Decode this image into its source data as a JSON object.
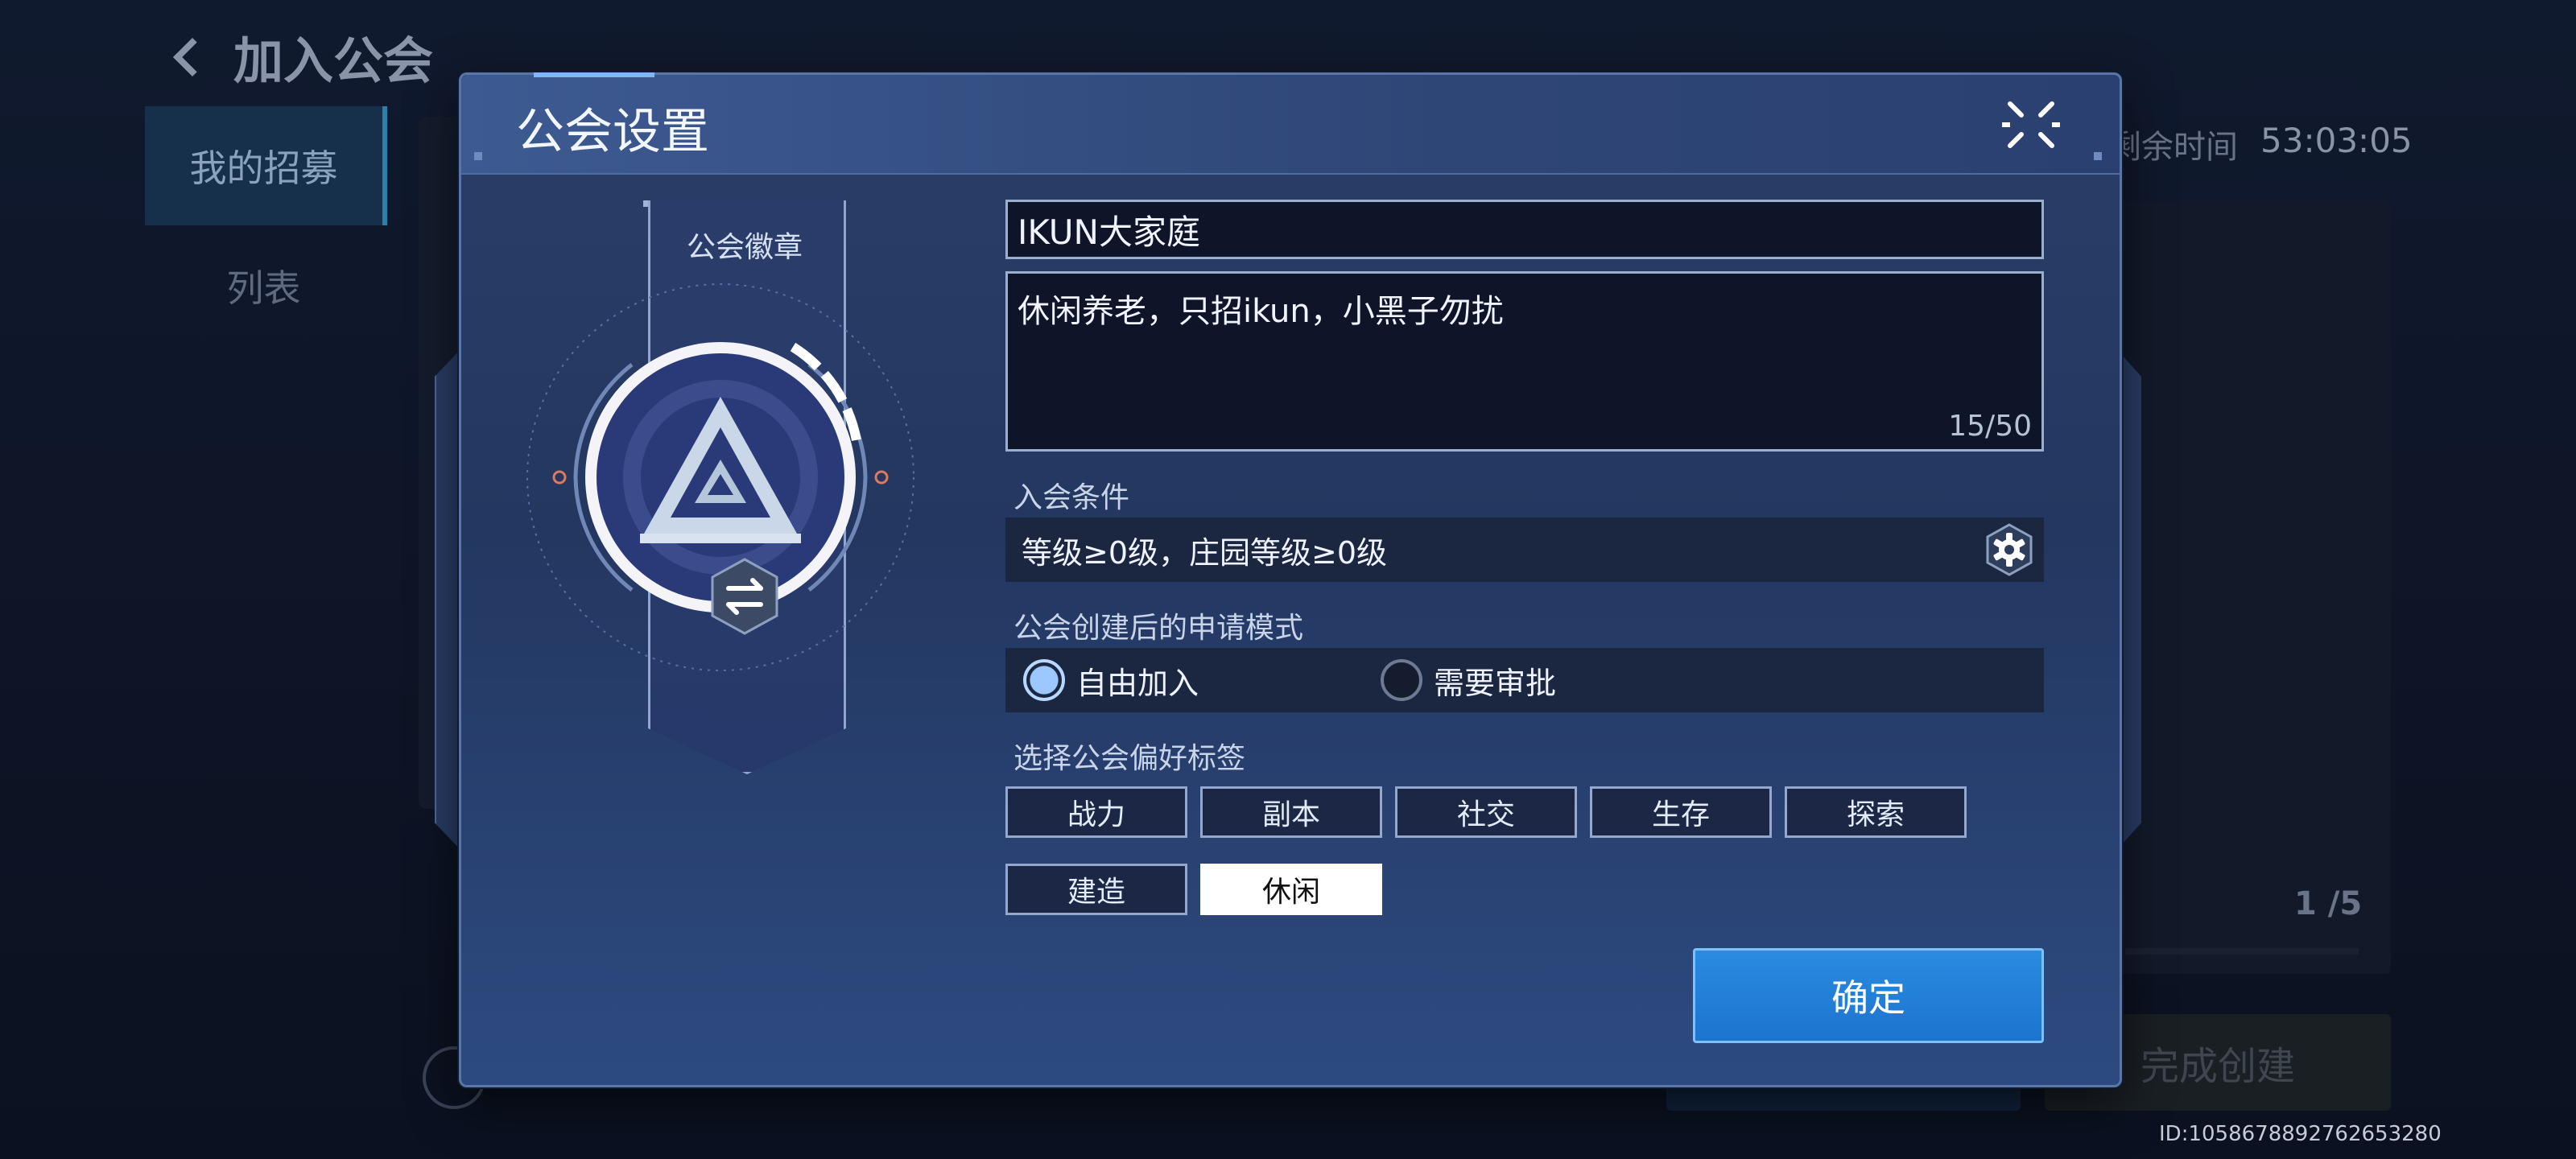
{
  "background": {
    "title": "加入公会",
    "tabs": [
      "我的招募",
      "列表"
    ],
    "timer_label": "剩余时间",
    "timer_value": "53:03:05",
    "member_count": "1 /5",
    "complete_button": "完成创建",
    "user_id": "ID:1058678892762653280"
  },
  "dialog": {
    "title": "公会设置",
    "emblem_label": "公会徽章",
    "name_value": "IKUN大家庭",
    "description_value": "休闲养老，只招ikun，小黑子勿扰",
    "description_counter": "15/50",
    "join_conditions_label": "入会条件",
    "join_conditions_value": "等级≥0级，庄园等级≥0级",
    "apply_mode_label": "公会创建后的申请模式",
    "apply_modes": [
      {
        "label": "自由加入",
        "selected": true
      },
      {
        "label": "需要审批",
        "selected": false
      }
    ],
    "tags_label": "选择公会偏好标签",
    "tags": [
      {
        "label": "战力",
        "selected": false
      },
      {
        "label": "副本",
        "selected": false
      },
      {
        "label": "社交",
        "selected": false
      },
      {
        "label": "生存",
        "selected": false
      },
      {
        "label": "探索",
        "selected": false
      },
      {
        "label": "建造",
        "selected": false
      },
      {
        "label": "休闲",
        "selected": true
      }
    ],
    "confirm_button": "确定"
  },
  "icons": [
    "back-arrow-icon",
    "close-icon",
    "swap-icon",
    "gear-icon",
    "guild-emblem-icon",
    "flag-icon"
  ],
  "colors": {
    "accent_blue": "#2a8be0",
    "dialog_bg": "#2b3e68"
  }
}
